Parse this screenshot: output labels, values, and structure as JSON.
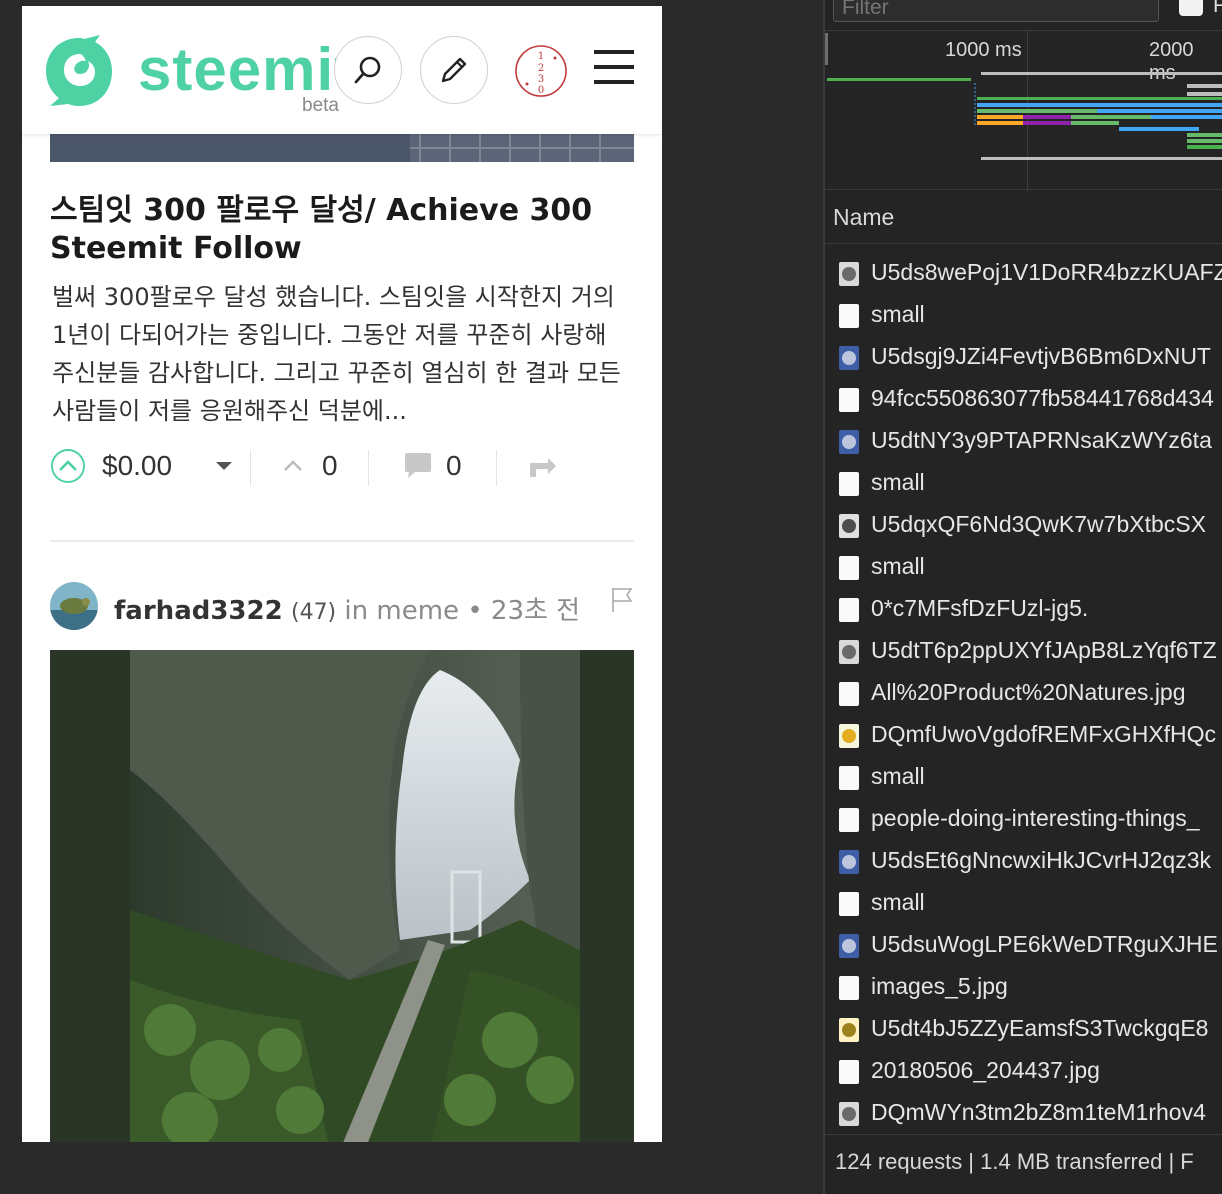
{
  "steemit": {
    "logo_text": "steemit",
    "logo_beta": "beta",
    "avatar_digits": [
      "1",
      "2",
      "3",
      "0"
    ],
    "post": {
      "title": "스팀잇 300 팔로우 달성/ Achieve 300 Steemit Follow",
      "excerpt": "벌써 300팔로우 달성 했습니다. 스팀잇을 시작한지 거의 1년이 다되어가는 중입니다. 그동안 저를 꾸준히 사랑해 주신분들 감사합니다. 그리고 꾸준히 열심히 한 결과 모든 사람들이 저를 응원해주신 덕분에...",
      "payout": "$0.00",
      "votes": "0",
      "comments": "0"
    },
    "next_post": {
      "author": "farhad3322",
      "reputation": "(47)",
      "in_label": "in",
      "category": "meme",
      "time": "• 23초 전"
    },
    "colors": {
      "brand": "#4ed2a4"
    }
  },
  "devtools": {
    "filter_placeholder": "Filter",
    "filter_more": "F",
    "timeline_ticks": [
      "1000 ms",
      "2000 ms"
    ],
    "name_header": "Name",
    "requests": [
      {
        "name": "U5ds8wePoj1V1DoRR4bzzKUAFZ",
        "icon": "avatar-thumb"
      },
      {
        "name": "small",
        "icon": "blank-file"
      },
      {
        "name": "U5dsgj9JZi4FevtjvB6Bm6DxNUT",
        "icon": "image-thumb"
      },
      {
        "name": "94fcc550863077fb58441768d434",
        "icon": "blank-file"
      },
      {
        "name": "U5dtNY3y9PTAPRNsaKzWYz6ta",
        "icon": "image-thumb"
      },
      {
        "name": "small",
        "icon": "blank-file"
      },
      {
        "name": "U5dqxQF6Nd3QwK7w7bXtbcSX",
        "icon": "logo-thumb"
      },
      {
        "name": "small",
        "icon": "blank-file"
      },
      {
        "name": "0*c7MFsfDzFUzl-jg5.",
        "icon": "blank-file"
      },
      {
        "name": "U5dtT6p2ppUXYfJApB8LzYqf6TZ",
        "icon": "avatar-thumb"
      },
      {
        "name": "All%20Product%20Natures.jpg",
        "icon": "blank-file"
      },
      {
        "name": "DQmfUwoVgdofREMFxGHXfHQc",
        "icon": "clover-thumb"
      },
      {
        "name": "small",
        "icon": "blank-file"
      },
      {
        "name": "people-doing-interesting-things_",
        "icon": "blank-file"
      },
      {
        "name": "U5dsEt6gNncwxiHkJCvrHJ2qz3k",
        "icon": "image-thumb"
      },
      {
        "name": "small",
        "icon": "blank-file"
      },
      {
        "name": "U5dsuWogLPE6kWeDTRguXJHE",
        "icon": "image-thumb"
      },
      {
        "name": "images_5.jpg",
        "icon": "blank-file"
      },
      {
        "name": "U5dt4bJ5ZZyEamsfS3TwckgqE8",
        "icon": "cartoon-thumb"
      },
      {
        "name": "20180506_204437.jpg",
        "icon": "blank-file"
      },
      {
        "name": "DQmWYn3tm2bZ8m1teM1rhov4",
        "icon": "avatar-thumb"
      }
    ],
    "status": "124 requests | 1.4 MB transferred | F"
  }
}
